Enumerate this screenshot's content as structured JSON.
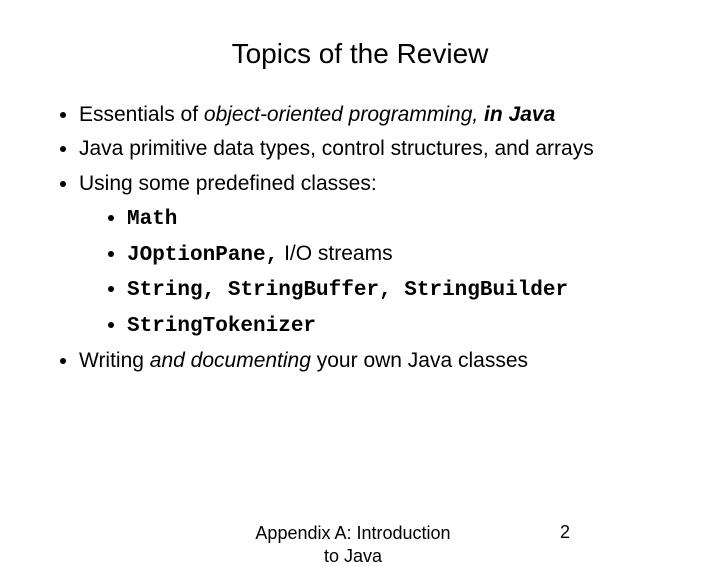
{
  "title": "Topics of the Review",
  "bullets": {
    "b1_a": "Essentials of ",
    "b1_b": "object-oriented programming, ",
    "b1_c": "in Java",
    "b2": "Java primitive data types, control structures, and arrays",
    "b3": "Using some predefined classes:",
    "b3_1": "Math",
    "b3_2a": "JOptionPane,",
    "b3_2b": " I/O streams",
    "b3_3a": "String",
    "b3_3b": ", ",
    "b3_3c": "StringBuffer, StringBuilder",
    "b3_4": "StringTokenizer",
    "b4_a": "Writing ",
    "b4_b": "and documenting",
    "b4_c": " your own Java classes"
  },
  "footer": {
    "text": "Appendix A: Introduction to Java",
    "page": "2"
  }
}
